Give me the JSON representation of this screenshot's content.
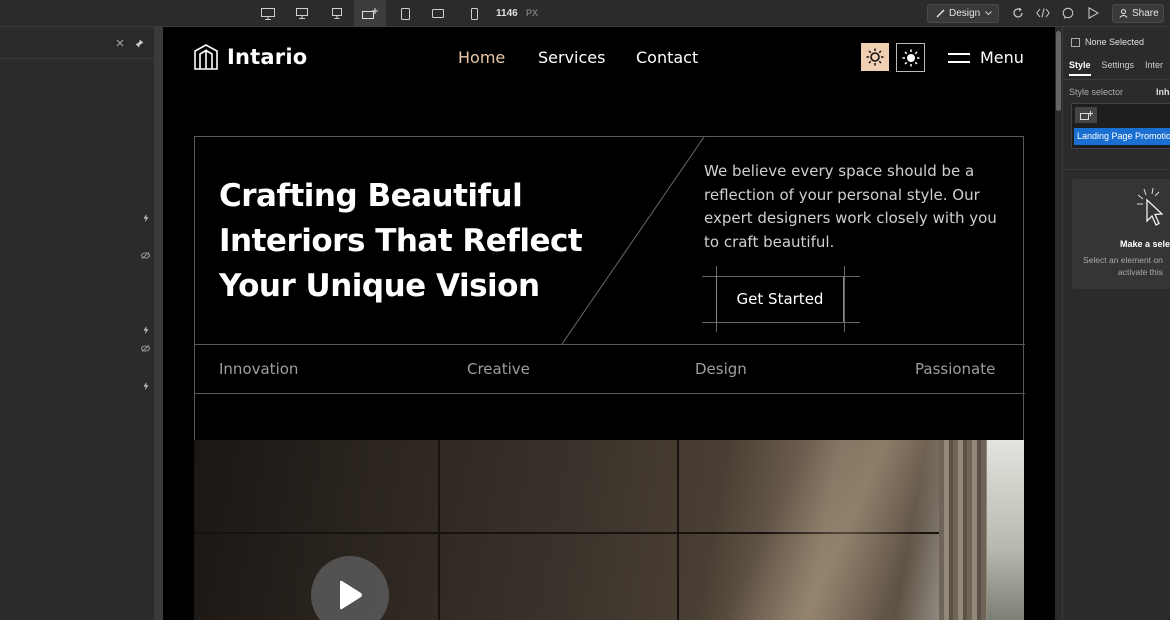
{
  "toolbar": {
    "devices": [
      "desktop-large",
      "desktop",
      "laptop",
      "custom-width",
      "tablet",
      "tablet-landscape",
      "mobile"
    ],
    "active_device": "custom-width",
    "canvas_width": "1146",
    "canvas_unit": "PX",
    "mode_label": "Design",
    "share_label": "Share"
  },
  "site": {
    "brand": "Intario",
    "nav": [
      "Home",
      "Services",
      "Contact"
    ],
    "active_nav": "Home",
    "menu_label": "Menu",
    "hero_title": "Crafting Beautiful Interiors That Reflect Your Unique Vision",
    "hero_description": "We believe every space should be a reflection of your personal style. Our expert designers work closely with you to craft beautiful.",
    "cta_label": "Get Started",
    "tags": [
      "Innovation",
      "Creative",
      "Design",
      "Passionate"
    ]
  },
  "right_panel": {
    "selection_label": "None Selected",
    "tabs": [
      "Style",
      "Settings",
      "Inter"
    ],
    "active_tab": "Style",
    "style_selector_label": "Style selector",
    "inherit_label": "Inhe",
    "selector_chip": "Landing Page Promotio",
    "empty_title": "Make a sele",
    "empty_line1": "Select an element on",
    "empty_line2": "activate this"
  },
  "colors": {
    "editor_bg": "#2b2b2b",
    "canvas_bg": "#000000",
    "accent_nav": "#e8c8a8",
    "theme_light_bg": "#f0cfb2",
    "chip_blue": "#1a6fd0"
  }
}
